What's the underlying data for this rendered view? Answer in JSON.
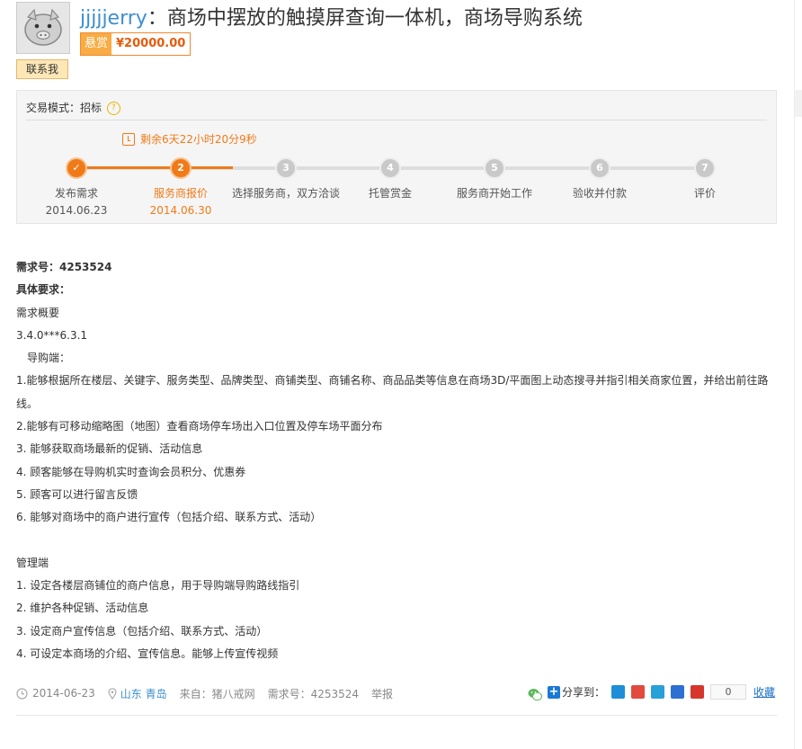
{
  "header": {
    "username": "jjjjjerry",
    "title_separator": "：",
    "title": "商场中摆放的触摸屏查询一体机，商场导购系统",
    "bounty_label": "悬赏",
    "bounty_amount": "¥20000.00",
    "contact_label": "联系我"
  },
  "trade": {
    "mode_label": "交易模式：",
    "mode_value": "招标",
    "help_icon": "?",
    "countdown": "剩余6天22小时20分9秒",
    "steps": [
      {
        "num": "✓",
        "label": "发布需求",
        "date": "2014.06.23",
        "state": "done"
      },
      {
        "num": "2",
        "label": "服务商报价",
        "date": "2014.06.30",
        "state": "active"
      },
      {
        "num": "3",
        "label": "选择服务商，双方洽谈",
        "date": "",
        "state": "todo"
      },
      {
        "num": "4",
        "label": "托管赏金",
        "date": "",
        "state": "todo"
      },
      {
        "num": "5",
        "label": "服务商开始工作",
        "date": "",
        "state": "todo"
      },
      {
        "num": "6",
        "label": "验收并付款",
        "date": "",
        "state": "todo"
      },
      {
        "num": "7",
        "label": "评价",
        "date": "",
        "state": "todo"
      }
    ]
  },
  "content": {
    "req_id": "需求号：4253524",
    "req_title": "具体要求：",
    "lines": [
      "需求概要",
      "3.4.0***6.3.1",
      "　导购端：",
      "1.能够根据所在楼层、关键字、服务类型、品牌类型、商铺类型、商铺名称、商品品类等信息在商场3D/平面图上动态搜寻并指引相关商家位置，并给出前往路",
      "线。",
      "2.能够有可移动缩略图（地图）查看商场停车场出入口位置及停车场平面分布",
      "  3. 能够获取商场最新的促销、活动信息",
      "  4. 顾客能够在导购机实时查询会员积分、优惠券",
      "  5. 顾客可以进行留言反馈",
      "  6. 能够对商场中的商户进行宣传（包括介绍、联系方式、活动）",
      "",
      "  管理端",
      "  1. 设定各楼层商铺位的商户信息，用于导购端导购路线指引",
      "  2. 维护各种促销、活动信息",
      "  3. 设定商户宣传信息（包括介绍、联系方式、活动）",
      "  4. 可设定本商场的介绍、宣传信息。能够上传宣传视频"
    ]
  },
  "footer": {
    "date": "2014-06-23",
    "location": "山东 青岛",
    "source": "来自：猪八戒网",
    "req_no": "需求号：4253524",
    "report": "举报",
    "share_label": "分享到：",
    "share_count": "0",
    "favorite": "收藏"
  },
  "colors": {
    "accent": "#f07a18",
    "link": "#3d8fd1"
  }
}
